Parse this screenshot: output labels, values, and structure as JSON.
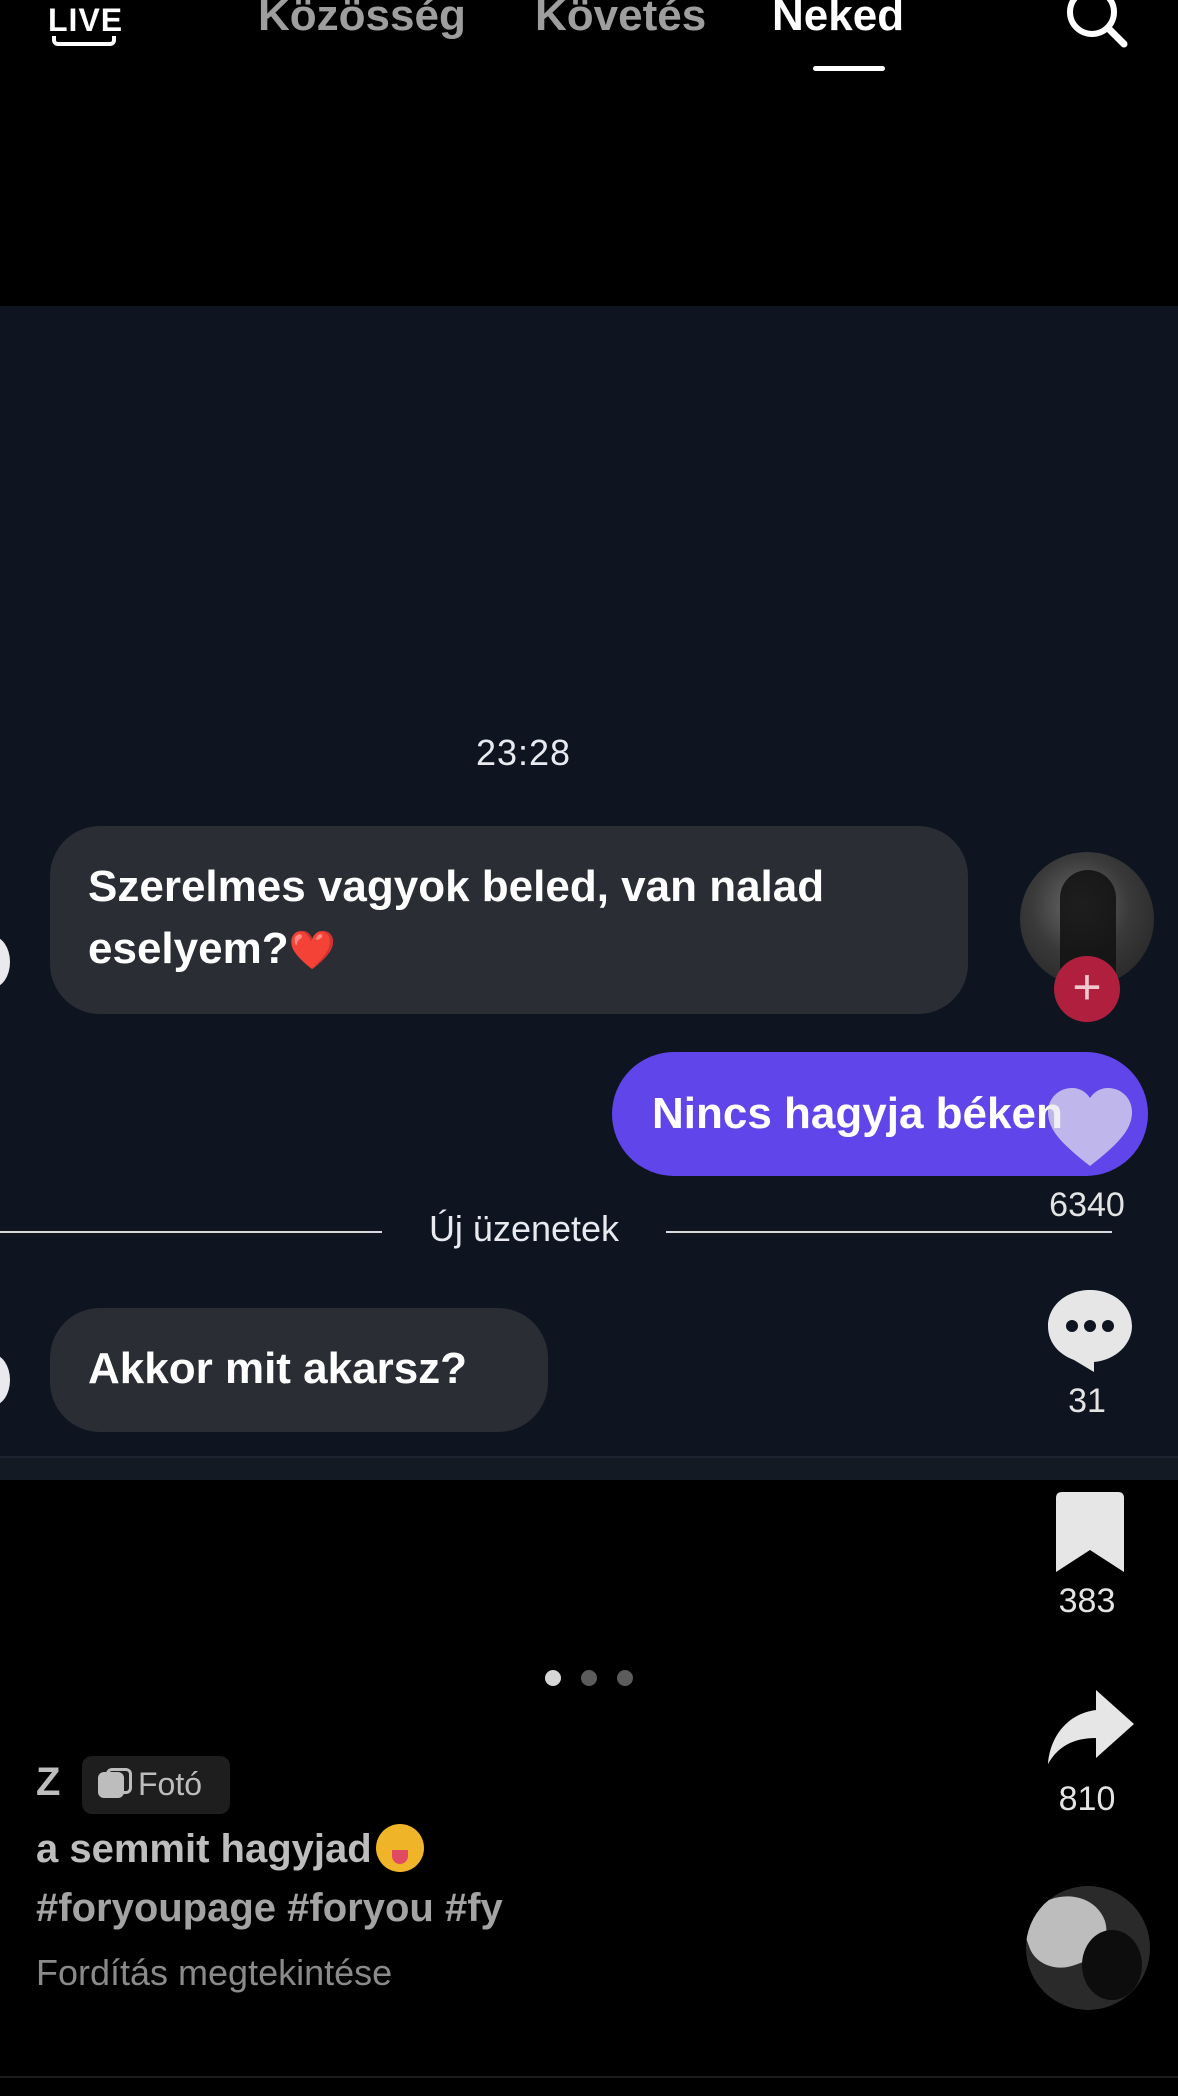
{
  "topbar": {
    "live_label": "LIVE",
    "tabs": [
      {
        "label": "Közösség"
      },
      {
        "label": "Követés"
      },
      {
        "label": "Neked"
      }
    ],
    "active_tab": "Neked"
  },
  "chat": {
    "timestamp": "23:28",
    "messages": [
      {
        "direction": "incoming",
        "text": "Szerelmes vagyok beled, van nalad eselyem?"
      },
      {
        "direction": "outgoing",
        "text": "Nincs hagyja béken"
      },
      {
        "direction": "incoming",
        "text": "Akkor mit akarsz?"
      }
    ],
    "divider_label": "Új üzenetek",
    "colors": {
      "incoming_bubble": "#2a2d33",
      "outgoing_bubble": "#5f45ea",
      "background": "#0e1521"
    }
  },
  "actions": {
    "likes": "6340",
    "comments": "31",
    "saves": "383",
    "shares": "810",
    "icons": [
      "heart-icon",
      "comment-icon",
      "bookmark-icon",
      "share-icon"
    ],
    "follow_color": "#b0203e"
  },
  "carousel": {
    "total": 3,
    "active_index": 0
  },
  "caption": {
    "author": "Z",
    "badge": "Fotó",
    "description": "a semmit hagyjad",
    "hashtags": "#foryoupage #foryou #fy",
    "translate": "Fordítás megtekintése"
  }
}
